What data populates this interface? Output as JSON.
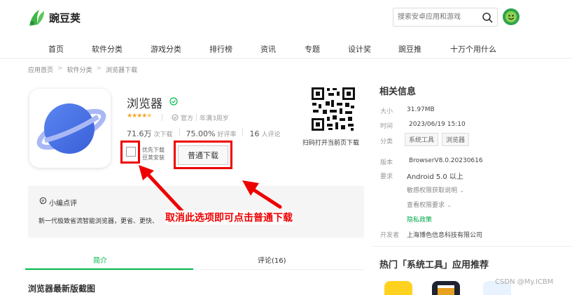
{
  "header": {
    "logo_text": "豌豆荚",
    "search_placeholder": "搜索安卓应用和游戏"
  },
  "nav": {
    "items": [
      "首页",
      "软件分类",
      "游戏分类",
      "排行榜",
      "资讯",
      "专题",
      "设计奖",
      "豌豆推",
      "十万个用什么"
    ]
  },
  "breadcrumb": [
    "应用首页",
    "软件分类",
    "浏览器下载"
  ],
  "app": {
    "name": "浏览器",
    "tag_official": "官方",
    "tag_age": "年满3周岁",
    "downloads_num": "71.6万",
    "downloads_unit": "次下载",
    "rating_num": "75.00%",
    "rating_unit": "好评率",
    "reviews_num": "16",
    "reviews_unit": "人评论",
    "checkbox_line1": "优先下载",
    "checkbox_line2": "豆荚安装",
    "download_button": "普通下载",
    "qr_caption": "扫码打开当前页下载"
  },
  "review": {
    "title": "小编点评",
    "text": "新一代极致省流智能浏览器，更省、更快、"
  },
  "annotation": "取消此选项即可点击普通下载",
  "tabs": [
    {
      "label": "简介",
      "active": true
    },
    {
      "label": "评论(16)",
      "active": false
    }
  ],
  "screenshots_title": "浏览器最新版截图",
  "info": {
    "title": "相关信息",
    "size_label": "大小",
    "size_value": "31.97MB",
    "time_label": "时间",
    "time_value": "2023/06/19 15:10",
    "category_label": "分类",
    "category_chips": [
      "系统工具",
      "浏览器"
    ],
    "version_label": "版本",
    "version_value": "BrowserV8.0.20230616",
    "requirement_label": "要求",
    "requirement_value": "Android 5.0 以上",
    "permissions_link": "敏感权限获取说明",
    "view_permissions": "查看权限要求",
    "privacy_link": "隐私政策",
    "developer_label": "开发者",
    "developer_value": "上海博色信息科技有限公司"
  },
  "recommend": {
    "title": "热门「系统工具」应用推荐"
  },
  "watermark": "CSDN @My.ICBM",
  "colors": {
    "accent": "#00b84b",
    "annotation_red": "#e00000",
    "star": "#f5a623"
  }
}
